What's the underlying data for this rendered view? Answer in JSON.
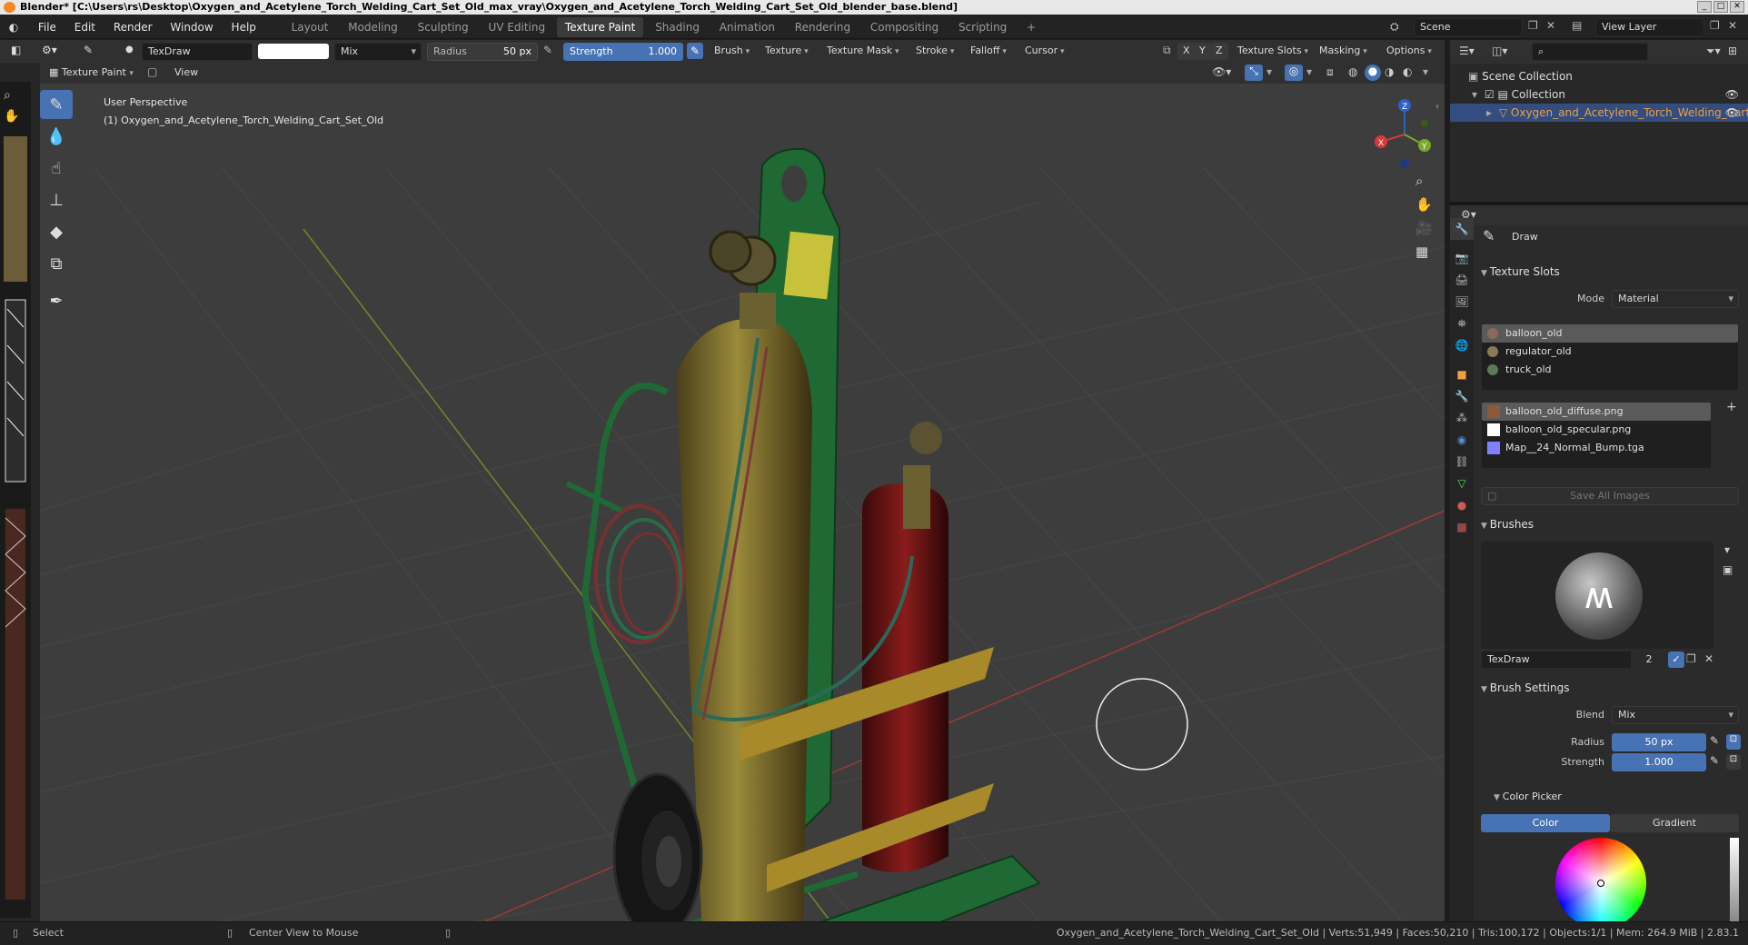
{
  "titlebar": {
    "title": "Blender* [C:\\Users\\rs\\Desktop\\Oxygen_and_Acetylene_Torch_Welding_Cart_Set_Old_max_vray\\Oxygen_and_Acetylene_Torch_Welding_Cart_Set_Old_blender_base.blend]"
  },
  "menu": [
    "File",
    "Edit",
    "Render",
    "Window",
    "Help"
  ],
  "workspaces": [
    "Layout",
    "Modeling",
    "Sculpting",
    "UV Editing",
    "Texture Paint",
    "Shading",
    "Animation",
    "Rendering",
    "Compositing",
    "Scripting"
  ],
  "topright": {
    "scene": "Scene",
    "view_layer": "View Layer"
  },
  "toolbar": {
    "brush_name": "TexDraw",
    "blend": "Mix",
    "radius_label": "Radius",
    "radius_value": "50 px",
    "strength_label": "Strength",
    "strength_value": "1.000",
    "brush": "Brush",
    "texture": "Texture",
    "texture_mask": "Texture Mask",
    "stroke": "Stroke",
    "falloff": "Falloff",
    "cursor": "Cursor",
    "axis_x": "X",
    "axis_y": "Y",
    "axis_z": "Z",
    "texture_slots": "Texture Slots",
    "masking": "Masking",
    "options": "Options"
  },
  "toolbar2": {
    "mode": "Texture Paint",
    "view": "View"
  },
  "viewport": {
    "perspective": "User Perspective",
    "object_label": "(1) Oxygen_and_Acetylene_Torch_Welding_Cart_Set_Old",
    "warning_label": "⚠",
    "gizmo": {
      "x": "X",
      "y": "Y",
      "z": "Z"
    }
  },
  "outliner": {
    "scene_collection": "Scene Collection",
    "collection": "Collection",
    "object": "Oxygen_and_Acetylene_Torch_Welding_Cart"
  },
  "props": {
    "tool_name": "Draw",
    "texture_slots_header": "Texture Slots",
    "mode_label": "Mode",
    "mode_value": "Material",
    "materials": [
      "balloon_old",
      "regulator_old",
      "truck_old"
    ],
    "images": [
      "balloon_old_diffuse.png",
      "balloon_old_specular.png",
      "Map__24_Normal_Bump.tga"
    ],
    "save_all": "Save All Images",
    "brushes_header": "Brushes",
    "brush_name": "TexDraw",
    "brush_users": "2",
    "brush_settings_header": "Brush Settings",
    "blend_label": "Blend",
    "blend_value": "Mix",
    "radius_label": "Radius",
    "radius_value": "50 px",
    "strength_label": "Strength",
    "strength_value": "1.000",
    "color_picker_header": "Color Picker",
    "color_tab": "Color",
    "gradient_tab": "Gradient"
  },
  "statusbar": {
    "select": "Select",
    "center_view": "Center View to Mouse",
    "stats": "Oxygen_and_Acetylene_Torch_Welding_Cart_Set_Old | Verts:51,949 | Faces:50,210 | Tris:100,172 | Objects:1/1 | Mem: 264.9 MiB | 2.83.1"
  },
  "colors": {
    "accent": "#4772b3",
    "header": "#303030",
    "viewport": "#3d3d3d",
    "cylinder_yellow": "#8a7a30",
    "cylinder_red": "#7a1a1a",
    "cart_green": "#1f6a34"
  }
}
